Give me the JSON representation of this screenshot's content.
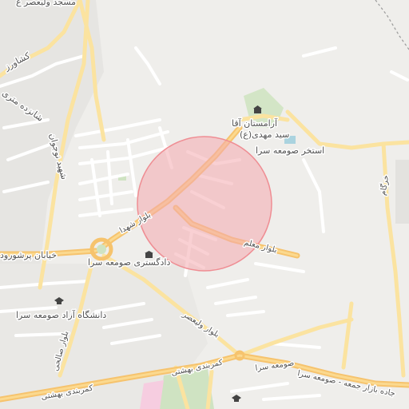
{
  "map": {
    "highlight_color": "#f4a9ae",
    "major_road_color": "#f6c36d",
    "secondary_road_color": "#fbe3a0",
    "labels": {
      "mosque_top": "مسجد ولیعصر ع",
      "road_keshavarz": "کشاورز",
      "road_shahid_nojavan": "شهید نوجوان",
      "road_shahrdari_16m": "شانزده متری",
      "cemetery": "آرامستان آقا",
      "seyed_mahdi": "سید مهدی(ع)",
      "pool": "استخر صومعه سرا",
      "blvd_shohada": "بلوار شهدا",
      "blvd_moallem": "بلوار معلم",
      "st_parshurud": "خیابان پرشورود",
      "courthouse": "دادگستری صومعه سرا",
      "university": "دانشگاه آزاد صومعه سرا",
      "blvd_valiasr": "بلوار ولیعصر",
      "blvd_salehi": "بلوار صالحی",
      "ring_beheshti_right": "کمربندی بهشتی",
      "ring_beheshti_left": "کمربندی بهشتی",
      "someh_sara_road": "صومعه سرا",
      "bazar_jomeh_road": "جاده بازار جمعه - صومعه سرا",
      "khorgam": "خرگام"
    }
  }
}
